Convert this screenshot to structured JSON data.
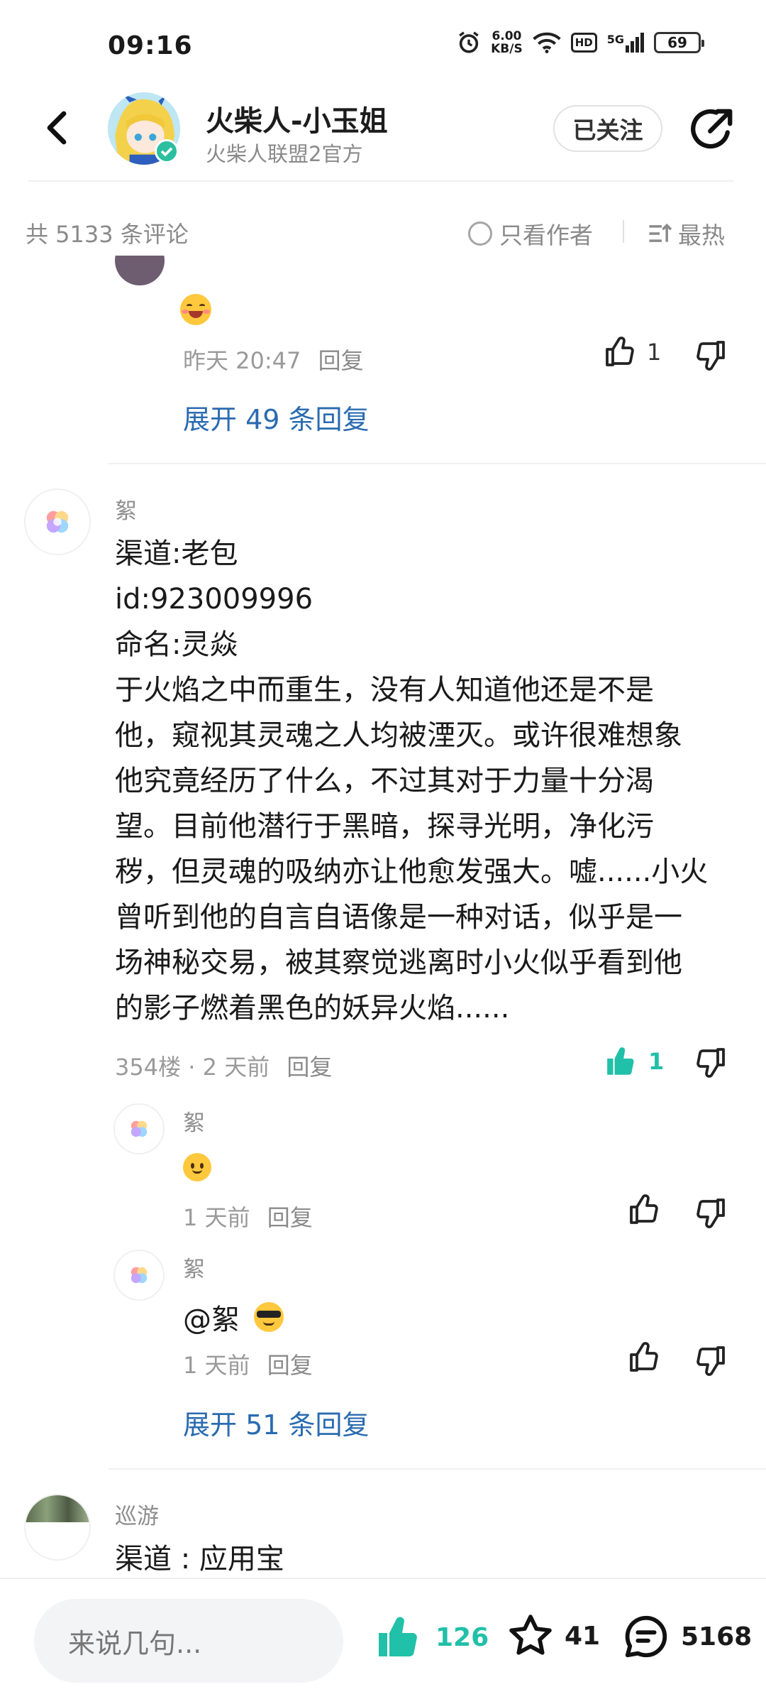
{
  "status": {
    "time": "09:16",
    "speed_value": "6.00",
    "speed_unit": "KB/S",
    "network": "5G",
    "hd": "HD",
    "battery": "69"
  },
  "header": {
    "author_name": "火柴人-小玉姐",
    "author_sub": "火柴人联盟2官方",
    "follow_label": "已关注",
    "icons": [
      "back-icon",
      "verified-icon",
      "share-icon"
    ]
  },
  "filter": {
    "comment_count": "共 5133 条评论",
    "author_only": "只看作者",
    "sort": "最热"
  },
  "comment_prev": {
    "time": "昨天 20:47",
    "reply": "回复",
    "likes": "1",
    "expand": "展开 49 条回复"
  },
  "comment_main": {
    "username": "絮",
    "lines": [
      "渠道:老包",
      "id:923009996",
      "命名:灵焱",
      "于火焰之中而重生，没有人知道他还是不是",
      "他，窥视其灵魂之人均被湮灭。或许很难想象",
      "他究竟经历了什么，不过其对于力量十分渴",
      "望。目前他潜行于黑暗，探寻光明，净化污",
      "秽，但灵魂的吸纳亦让他愈发强大。嘘......小火",
      "曾听到他的自言自语像是一种对话，似乎是一",
      "场神秘交易，被其察觉逃离时小火似乎看到他",
      "的影子燃着黑色的妖异火焰......"
    ],
    "floor_time": "354楼 · 2 天前",
    "reply": "回复",
    "likes": "1"
  },
  "reply_1": {
    "username": "絮",
    "time": "1 天前",
    "reply": "回复"
  },
  "reply_2": {
    "username": "絮",
    "mention": "@絮",
    "time": "1 天前",
    "reply": "回复"
  },
  "expand_main": "展开 51 条回复",
  "comment_next": {
    "username": "巡游",
    "text": "渠道 : 应用宝"
  },
  "bottom": {
    "placeholder": "来说几句...",
    "likes": "126",
    "stars": "41",
    "comments": "5168"
  },
  "colors": {
    "accent": "#21c0a8",
    "link": "#2a6bb0",
    "muted": "#8a8a8a"
  }
}
